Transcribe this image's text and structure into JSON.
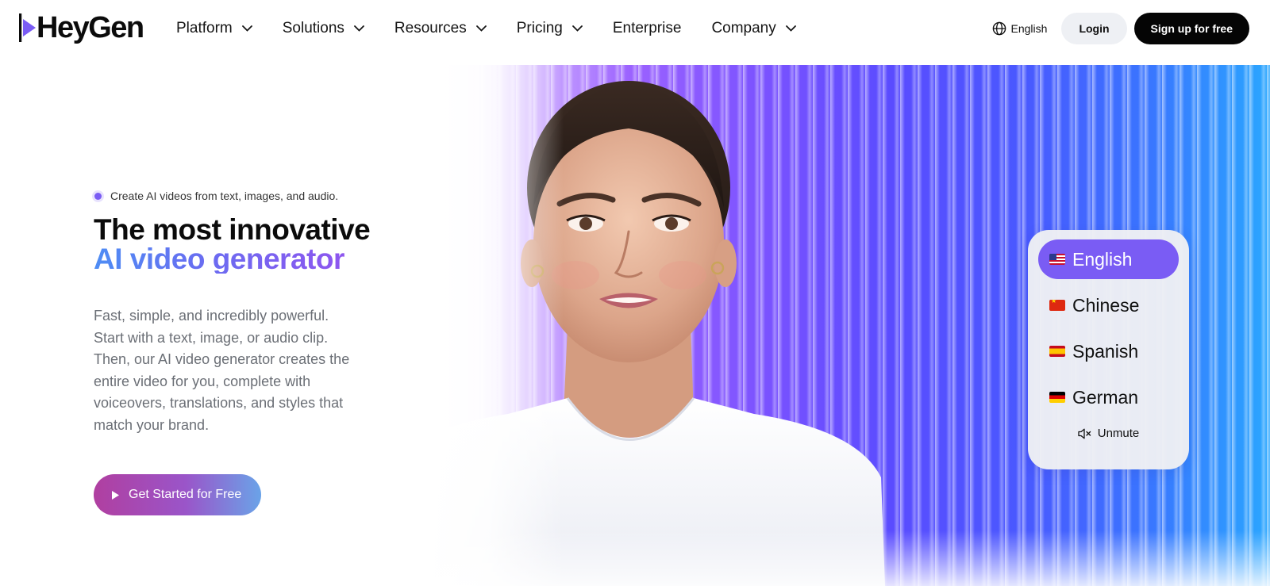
{
  "brand": {
    "logo_text": "HeyGen"
  },
  "nav": {
    "items": [
      {
        "label": "Platform",
        "has_dropdown": true
      },
      {
        "label": "Solutions",
        "has_dropdown": true
      },
      {
        "label": "Resources",
        "has_dropdown": true
      },
      {
        "label": "Pricing",
        "has_dropdown": true
      },
      {
        "label": "Enterprise",
        "has_dropdown": false
      },
      {
        "label": "Company",
        "has_dropdown": true
      }
    ],
    "language_label": "English",
    "login_label": "Login",
    "signup_label": "Sign up for free"
  },
  "hero": {
    "tagline": "Create AI videos from text, images, and audio.",
    "title_line1": "The most innovative",
    "title_line2": "AI video generator",
    "description": "Fast, simple, and incredibly powerful. Start with a text, image, or audio clip. Then, our AI video generator creates the entire video for you, complete with voiceovers, translations, and styles that match your brand.",
    "cta_label": "Get Started for Free"
  },
  "language_panel": {
    "options": [
      {
        "label": "English",
        "flag": "us-flag-icon",
        "active": true
      },
      {
        "label": "Chinese",
        "flag": "cn-flag-icon",
        "active": false
      },
      {
        "label": "Spanish",
        "flag": "es-flag-icon",
        "active": false
      },
      {
        "label": "German",
        "flag": "de-flag-icon",
        "active": false
      }
    ],
    "unmute_label": "Unmute"
  },
  "colors": {
    "accent": "#7a5cf4",
    "signup_bg": "#050505",
    "login_bg": "#eef0f4",
    "cta_gradient_start": "#b03fa0",
    "cta_gradient_end": "#6aa3e8"
  }
}
